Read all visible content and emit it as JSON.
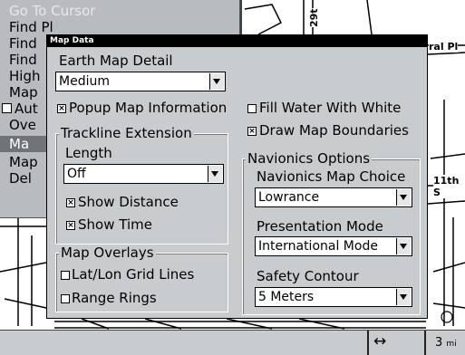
{
  "background_menu": {
    "items": [
      {
        "label": "Go To Cursor",
        "dim": true
      },
      {
        "label": "Find Pl"
      },
      {
        "label": "Find"
      },
      {
        "label": "Find"
      },
      {
        "label": "High"
      },
      {
        "label": "Map"
      },
      {
        "label": "Aut",
        "checkbox": true
      },
      {
        "label": "Ove"
      },
      {
        "label": "Ma",
        "selected": true
      },
      {
        "label": "Map"
      },
      {
        "label": "Del"
      }
    ]
  },
  "map": {
    "labels": {
      "street_top": "29t",
      "street_right": "ral Pl",
      "street_mid": "11th S"
    }
  },
  "dialog": {
    "title": "Map Data",
    "earth_map_detail": {
      "label": "Earth Map Detail",
      "value": "Medium"
    },
    "popup_map_information": {
      "label": "Popup Map Information",
      "checked": true
    },
    "fill_water_with_white": {
      "label": "Fill Water With White",
      "checked": false
    },
    "draw_map_boundaries": {
      "label": "Draw Map Boundaries",
      "checked": true
    },
    "trackline_extension": {
      "title": "Trackline Extension",
      "length_label": "Length",
      "length_value": "Off",
      "show_distance": {
        "label": "Show Distance",
        "checked": true
      },
      "show_time": {
        "label": "Show Time",
        "checked": true
      }
    },
    "map_overlays": {
      "title": "Map Overlays",
      "lat_lon_grid_lines": {
        "label": "Lat/Lon Grid Lines",
        "checked": false
      },
      "range_rings": {
        "label": "Range Rings",
        "checked": false
      }
    },
    "navionics_options": {
      "title": "Navionics Options",
      "map_choice_label": "Navionics Map Choice",
      "map_choice_value": "Lowrance",
      "presentation_mode_label": "Presentation Mode",
      "presentation_mode_value": "International Mode",
      "safety_contour_label": "Safety Contour",
      "safety_contour_value": "5 Meters"
    }
  },
  "status_bar": {
    "arrow_icon": "left-right-arrow-icon",
    "scale_value": "3",
    "scale_unit": "mi"
  },
  "colors": {
    "dialog_bg": "#c9ccce",
    "title_bar": "#000000",
    "menu_bg": "#b8bcc0",
    "menu_selected": "#6f7478"
  }
}
